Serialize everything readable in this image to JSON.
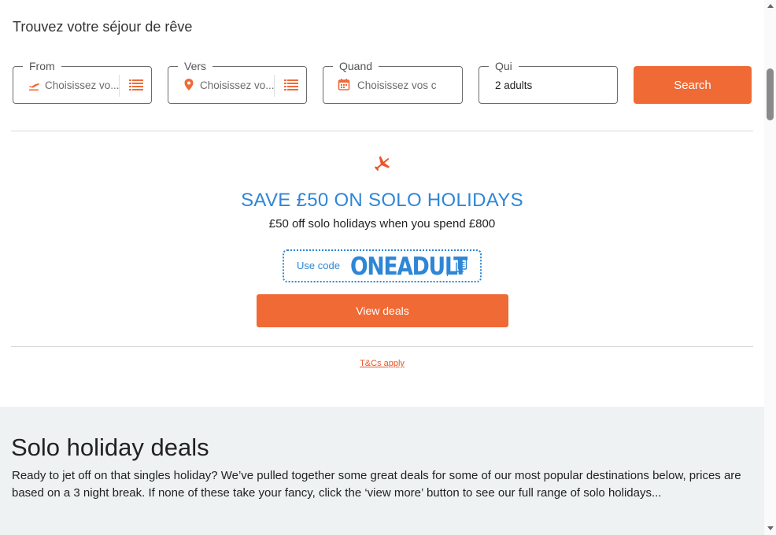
{
  "search": {
    "title": "Trouvez votre séjour de rêve",
    "from": {
      "legend": "From",
      "placeholder": "Choisissez vo..."
    },
    "to": {
      "legend": "Vers",
      "placeholder": "Choisissez vo..."
    },
    "when": {
      "legend": "Quand",
      "placeholder": "Choisissez vos c"
    },
    "who": {
      "legend": "Qui",
      "value": "2 adults"
    },
    "button_label": "Search"
  },
  "promo": {
    "icon": "plane-icon",
    "headline": "SAVE £50 ON SOLO HOLIDAYS",
    "subtext": "£50 off solo holidays when you spend £800",
    "code_label": "Use code",
    "code": "ONEADULT",
    "button_label": "View deals",
    "terms_link": "T&Cs apply"
  },
  "deals": {
    "title": "Solo holiday deals",
    "description": "Ready to jet off on that singles holiday? We’ve pulled together some great deals for some of our most popular destinations below, prices are based on a 3 night break. If none of these take your fancy, click the ‘view more’ button to see our full range of solo holidays..."
  },
  "colors": {
    "accent": "#f06a35",
    "promo_blue": "#2e86d6",
    "section_bg": "#eef2f3"
  }
}
